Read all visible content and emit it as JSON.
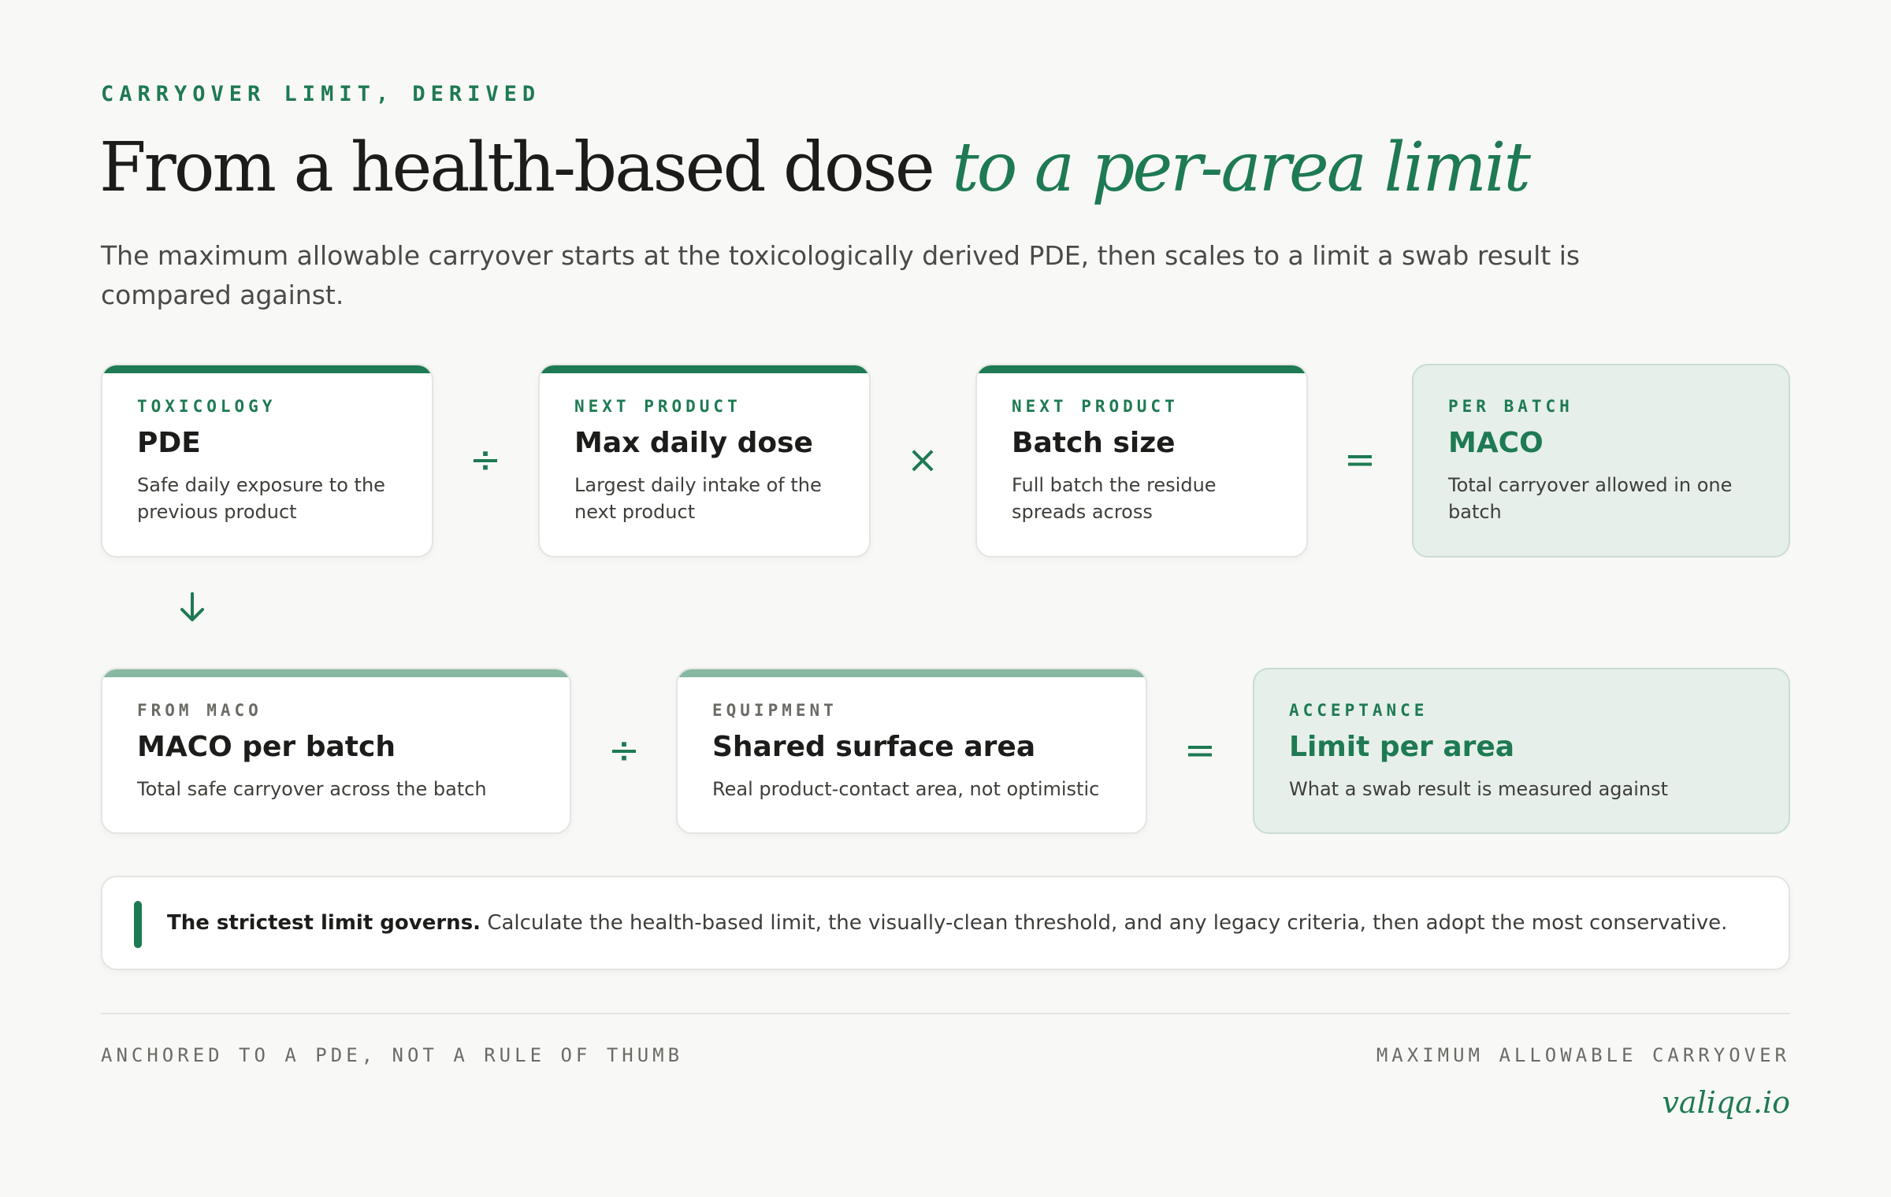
{
  "header": {
    "eyebrow": "CARRYOVER LIMIT, DERIVED",
    "title_main": "From a health-based dose ",
    "title_accent": "to a per-area limit",
    "subtitle": "The maximum allowable carryover starts at the toxicologically derived PDE, then scales to a limit a swab result is compared against."
  },
  "row1": {
    "cards": [
      {
        "kicker": "TOXICOLOGY",
        "heading": "PDE",
        "desc": "Safe daily exposure to the previous product"
      },
      {
        "kicker": "NEXT PRODUCT",
        "heading": "Max daily dose",
        "desc": "Largest daily intake of the next product"
      },
      {
        "kicker": "NEXT PRODUCT",
        "heading": "Batch size",
        "desc": "Full batch the residue spreads across"
      },
      {
        "kicker": "PER BATCH",
        "heading": "MACO",
        "desc": "Total carryover allowed in one batch"
      }
    ],
    "operators": [
      "÷",
      "×",
      "="
    ]
  },
  "row2": {
    "cards": [
      {
        "kicker": "FROM MACO",
        "heading": "MACO per batch",
        "desc": "Total safe carryover across the batch"
      },
      {
        "kicker": "EQUIPMENT",
        "heading": "Shared surface area",
        "desc": "Real product-contact area, not optimistic"
      },
      {
        "kicker": "ACCEPTANCE",
        "heading": "Limit per area",
        "desc": "What a swab result is measured against"
      }
    ],
    "operators": [
      "÷",
      "="
    ]
  },
  "note": {
    "bold": "The strictest limit governs.",
    "text": " Calculate the health-based limit, the visually-clean threshold, and any legacy criteria, then adopt the most conservative."
  },
  "footer": {
    "left": "ANCHORED TO A PDE, NOT A RULE OF THUMB",
    "right": "MAXIMUM ALLOWABLE CARRYOVER",
    "brand": "valiqa.io"
  },
  "icons": {
    "down_arrow": "arrow-down-icon"
  },
  "colors": {
    "accent": "#1e7a53",
    "result_bg": "#e6efe9",
    "background": "#f8f8f6"
  }
}
